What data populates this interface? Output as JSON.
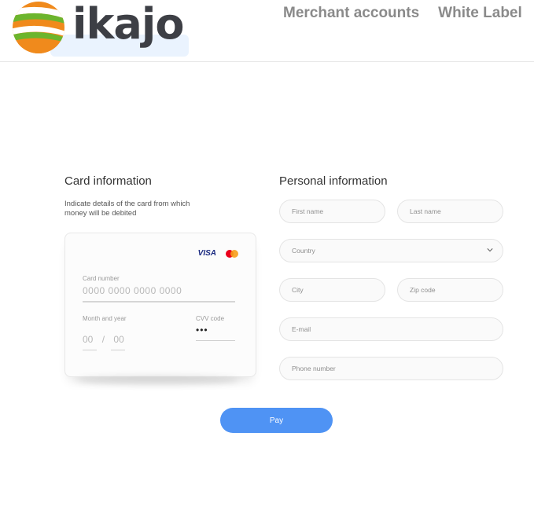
{
  "header": {
    "brand": "ikajo",
    "nav": [
      "Merchant accounts",
      "White Label"
    ]
  },
  "card_section": {
    "title": "Card information",
    "hint": "Indicate details of the card from which money will be debited",
    "brand_visa": "VISA",
    "card_number_label": "Card number",
    "card_number_placeholder": "0000 0000 0000 0000",
    "expiry_label": "Month and year",
    "month_placeholder": "00",
    "separator": "/",
    "year_placeholder": "00",
    "cvv_label": "CVV code",
    "cvv_value": "•••"
  },
  "personal_section": {
    "title": "Personal information",
    "first_name": "First name",
    "last_name": "Last name",
    "country": "Country",
    "city": "City",
    "zip": "Zip code",
    "email": "E-mail",
    "phone": "Phone number"
  },
  "actions": {
    "pay_label": "Pay"
  },
  "colors": {
    "accent": "#4f93f4",
    "logo_orange": "#f08a1c",
    "logo_green": "#6cb52d",
    "logo_text": "#3d3f45"
  }
}
